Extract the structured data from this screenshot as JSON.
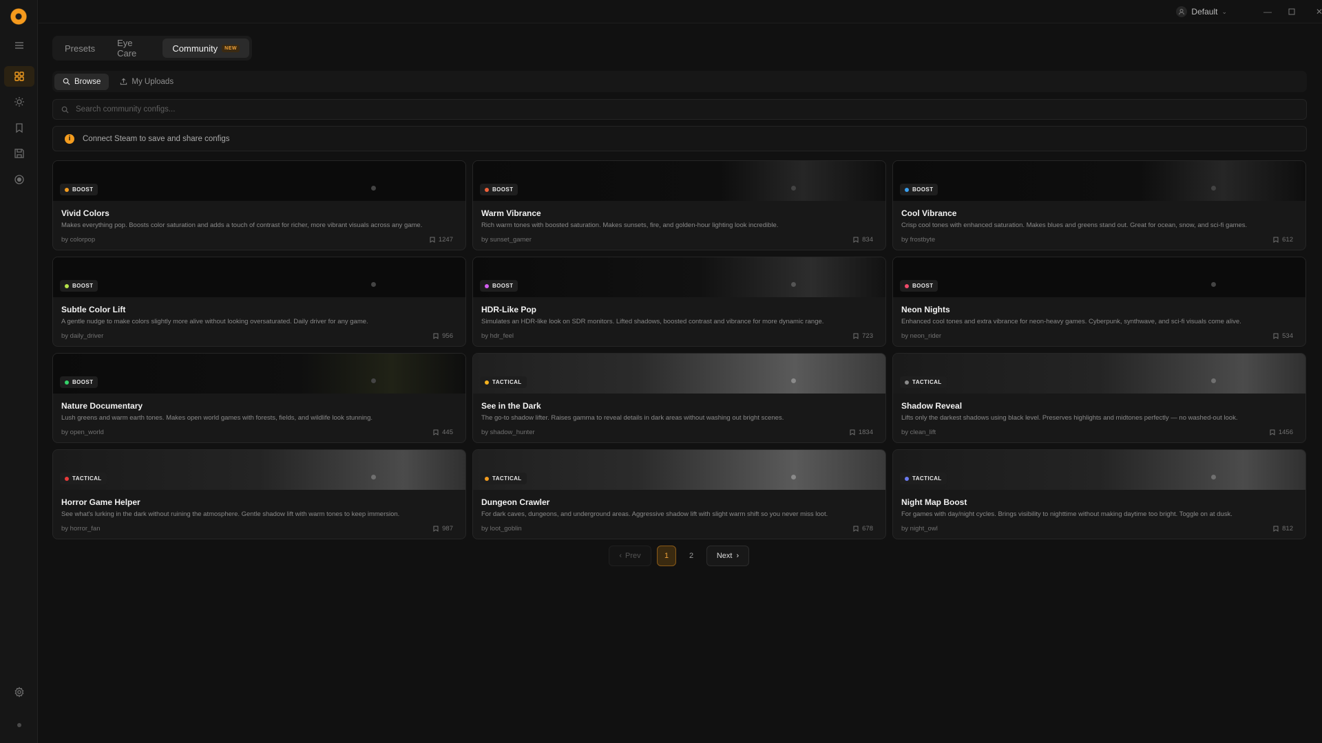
{
  "colors": {
    "accent": "#f39c1f",
    "boost": "#f39c1f"
  },
  "titlebar": {
    "profile_name": "Default"
  },
  "main_tabs": [
    {
      "label": "Presets"
    },
    {
      "label": "Eye Care"
    },
    {
      "label": "Community",
      "badge": "NEW"
    }
  ],
  "sub_tabs": [
    {
      "label": "Browse",
      "icon": "search-icon"
    },
    {
      "label": "My Uploads",
      "icon": "upload-icon"
    }
  ],
  "search": {
    "placeholder": "Search community configs..."
  },
  "notice": {
    "text": "Connect Steam to save and share configs"
  },
  "cards": [
    {
      "category": "BOOST",
      "dot": "#f39c1f",
      "title": "Vivid Colors",
      "desc": "Makes everything pop. Boosts color saturation and adds a touch of contrast for richer, more vibrant visuals across any game.",
      "author": "by colorpop",
      "saves": "1247"
    },
    {
      "category": "BOOST",
      "dot": "#f0603a",
      "title": "Warm Vibrance",
      "desc": "Rich warm tones with boosted saturation. Makes sunsets, fire, and golden-hour lighting look incredible.",
      "author": "by sunset_gamer",
      "saves": "834"
    },
    {
      "category": "BOOST",
      "dot": "#3aa0f0",
      "title": "Cool Vibrance",
      "desc": "Crisp cool tones with enhanced saturation. Makes blues and greens stand out. Great for ocean, snow, and sci-fi games.",
      "author": "by frostbyte",
      "saves": "612"
    },
    {
      "category": "BOOST",
      "dot": "#b6e34a",
      "title": "Subtle Color Lift",
      "desc": "A gentle nudge to make colors slightly more alive without looking oversaturated. Daily driver for any game.",
      "author": "by daily_driver",
      "saves": "956"
    },
    {
      "category": "BOOST",
      "dot": "#d35ef0",
      "title": "HDR-Like Pop",
      "desc": "Simulates an HDR-like look on SDR monitors. Lifted shadows, boosted contrast and vibrance for more dynamic range.",
      "author": "by hdr_feel",
      "saves": "723"
    },
    {
      "category": "BOOST",
      "dot": "#f04a6a",
      "title": "Neon Nights",
      "desc": "Enhanced cool tones and extra vibrance for neon-heavy games. Cyberpunk, synthwave, and sci-fi visuals come alive.",
      "author": "by neon_rider",
      "saves": "534"
    },
    {
      "category": "BOOST",
      "dot": "#34d36a",
      "title": "Nature Documentary",
      "desc": "Lush greens and warm earth tones. Makes open world games with forests, fields, and wildlife look stunning.",
      "author": "by open_world",
      "saves": "445"
    },
    {
      "category": "TACTICAL",
      "dot": "#f5b21f",
      "title": "See in the Dark",
      "desc": "The go-to shadow lifter. Raises gamma to reveal details in dark areas without washing out bright scenes.",
      "author": "by shadow_hunter",
      "saves": "1834"
    },
    {
      "category": "TACTICAL",
      "dot": "#8a8a8a",
      "title": "Shadow Reveal",
      "desc": "Lifts only the darkest shadows using black level. Preserves highlights and midtones perfectly — no washed-out look.",
      "author": "by clean_lift",
      "saves": "1456"
    },
    {
      "category": "TACTICAL",
      "dot": "#e83a3a",
      "title": "Horror Game Helper",
      "desc": "See what's lurking in the dark without ruining the atmosphere. Gentle shadow lift with warm tones to keep immersion.",
      "author": "by horror_fan",
      "saves": "987"
    },
    {
      "category": "TACTICAL",
      "dot": "#f39c1f",
      "title": "Dungeon Crawler",
      "desc": "For dark caves, dungeons, and underground areas. Aggressive shadow lift with slight warm shift so you never miss loot.",
      "author": "by loot_goblin",
      "saves": "678"
    },
    {
      "category": "TACTICAL",
      "dot": "#6a7af0",
      "title": "Night Map Boost",
      "desc": "For games with day/night cycles. Brings visibility to nighttime without making daytime too bright. Toggle on at dusk.",
      "author": "by night_owl",
      "saves": "812"
    }
  ],
  "pagination": {
    "prev": "Prev",
    "pages": [
      "1",
      "2"
    ],
    "current": "1",
    "next": "Next"
  }
}
